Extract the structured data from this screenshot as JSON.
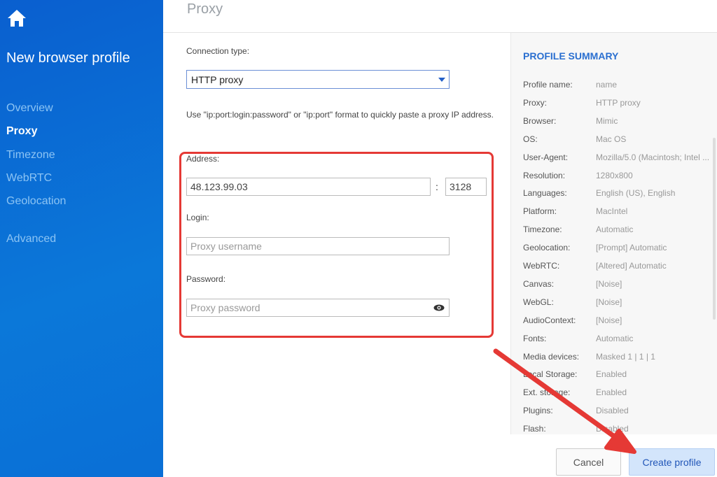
{
  "sidebar": {
    "title": "New browser profile",
    "items": [
      {
        "label": "Overview"
      },
      {
        "label": "Proxy"
      },
      {
        "label": "Timezone"
      },
      {
        "label": "WebRTC"
      },
      {
        "label": "Geolocation"
      },
      {
        "label": "Advanced"
      }
    ],
    "active": "Proxy"
  },
  "main": {
    "title": "Proxy",
    "connection_label": "Connection type:",
    "connection_value": "HTTP proxy",
    "hint": "Use \"ip:port:login:password\" or \"ip:port\" format to quickly paste a proxy IP address.",
    "address_label": "Address:",
    "address_value": "48.123.99.03",
    "port_value": "3128",
    "login_label": "Login:",
    "login_placeholder": "Proxy username",
    "password_label": "Password:",
    "password_placeholder": "Proxy password"
  },
  "summary": {
    "title": "PROFILE SUMMARY",
    "rows": [
      {
        "k": "Profile name:",
        "v": "name"
      },
      {
        "k": "Proxy:",
        "v": "HTTP proxy"
      },
      {
        "k": "Browser:",
        "v": "Mimic"
      },
      {
        "k": "OS:",
        "v": "Mac OS"
      },
      {
        "k": "User-Agent:",
        "v": "Mozilla/5.0 (Macintosh; Intel ..."
      },
      {
        "k": "Resolution:",
        "v": "1280x800"
      },
      {
        "k": "Languages:",
        "v": "English (US), English"
      },
      {
        "k": "Platform:",
        "v": "MacIntel"
      },
      {
        "k": "Timezone:",
        "v": "Automatic"
      },
      {
        "k": "Geolocation:",
        "v": "[Prompt] Automatic"
      },
      {
        "k": "WebRTC:",
        "v": "[Altered] Automatic"
      },
      {
        "k": "Canvas:",
        "v": "[Noise]"
      },
      {
        "k": "WebGL:",
        "v": "[Noise]"
      },
      {
        "k": "AudioContext:",
        "v": "[Noise]"
      },
      {
        "k": "Fonts:",
        "v": "Automatic"
      },
      {
        "k": "Media devices:",
        "v": "Masked 1 | 1 | 1"
      },
      {
        "k": "Local Storage:",
        "v": "Enabled"
      },
      {
        "k": "Ext. storage:",
        "v": "Enabled"
      },
      {
        "k": "Plugins:",
        "v": "Disabled"
      },
      {
        "k": "Flash:",
        "v": "Disabled"
      }
    ]
  },
  "buttons": {
    "cancel": "Cancel",
    "create": "Create profile"
  },
  "colors": {
    "sidebar": "#0a6fd6",
    "highlight": "#e53935",
    "accent": "#2a6fd0"
  },
  "icons": {
    "home": "home-icon",
    "eye": "eye-icon",
    "caret": "caret-down-icon"
  }
}
